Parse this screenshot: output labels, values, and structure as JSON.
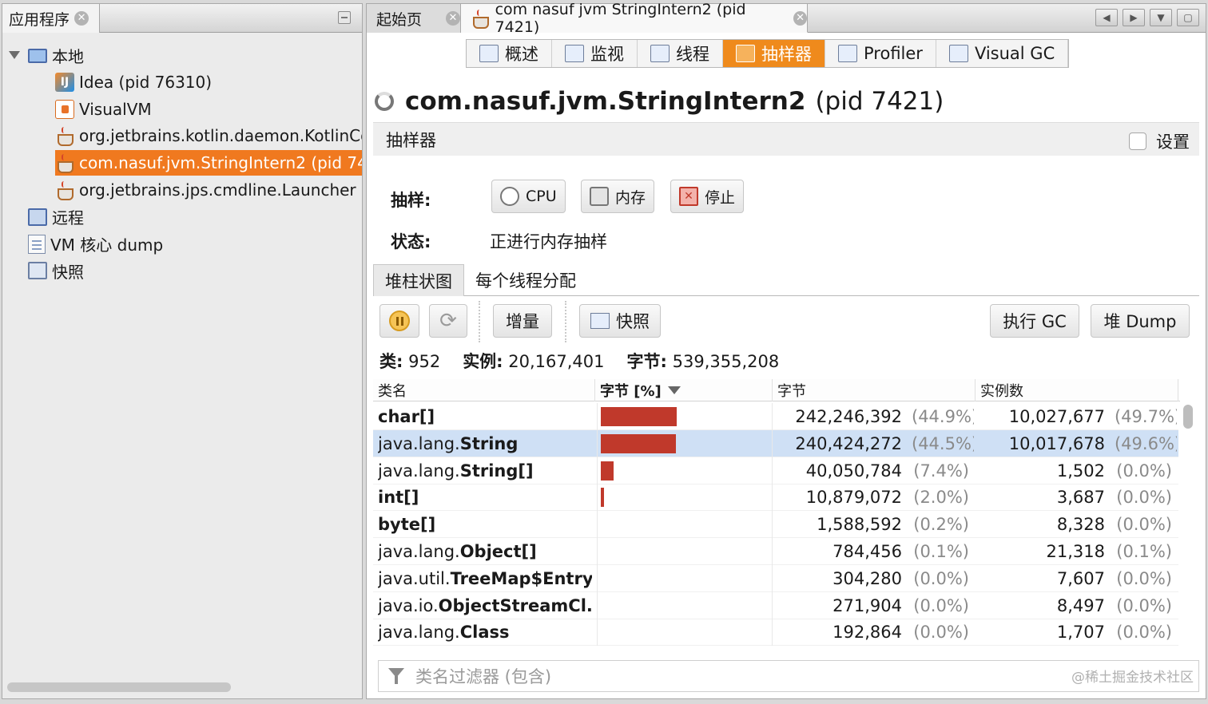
{
  "left_panel": {
    "tab_label": "应用程序",
    "tree": [
      {
        "label": "本地",
        "icon": "computer-icon",
        "level": 0,
        "expandable": true
      },
      {
        "label": "Idea (pid 76310)",
        "icon": "idea-icon",
        "level": 1
      },
      {
        "label": "VisualVM",
        "icon": "visualvm-icon",
        "level": 1
      },
      {
        "label": "org.jetbrains.kotlin.daemon.KotlinCo",
        "icon": "java-coffee-icon",
        "level": 1
      },
      {
        "label": "com.nasuf.jvm.StringIntern2 (pid 74",
        "icon": "java-coffee-icon",
        "level": 1,
        "selected": true
      },
      {
        "label": "org.jetbrains.jps.cmdline.Launcher (",
        "icon": "java-coffee-icon",
        "level": 1
      },
      {
        "label": "远程",
        "icon": "remote-host-icon",
        "level": 0
      },
      {
        "label": "VM 核心 dump",
        "icon": "core-dump-icon",
        "level": 0
      },
      {
        "label": "快照",
        "icon": "snapshot-icon",
        "level": 0
      }
    ]
  },
  "right_panel": {
    "tabs": [
      {
        "label": "起始页"
      },
      {
        "label": "com nasuf jvm StringIntern2 (pid 7421)",
        "active": true
      }
    ],
    "subtabs": [
      "概述",
      "监视",
      "线程",
      "抽样器",
      "Profiler",
      "Visual GC"
    ],
    "active_subtab": "抽样器",
    "app_title_name": "com.nasuf.jvm.StringIntern2",
    "app_title_pid": "(pid 7421)",
    "section_title": "抽样器",
    "settings_label": "设置",
    "sample_label": "抽样:",
    "buttons": {
      "cpu": "CPU",
      "memory": "内存",
      "stop": "停止"
    },
    "status_label": "状态:",
    "status_value": "正进行内存抽样",
    "view_tabs": [
      "堆柱状图",
      "每个线程分配"
    ],
    "toolbar": {
      "delta": "增量",
      "snapshot": "快照",
      "gc": "执行 GC",
      "heap_dump": "堆 Dump"
    },
    "summary": {
      "classes_label": "类:",
      "classes_value": "952",
      "instances_label": "实例:",
      "instances_value": "20,167,401",
      "bytes_label": "字节:",
      "bytes_value": "539,355,208"
    },
    "table": {
      "columns": [
        "类名",
        "字节 [%]",
        "字节",
        "实例数"
      ],
      "sorted_column": "字节 [%]",
      "rows": [
        {
          "pkg": "",
          "cls": "char[]",
          "bytes": "242,246,392",
          "bytes_pct": "(44.9%)",
          "inst": "10,027,677",
          "inst_pct": "(49.7%)",
          "share": 0.449
        },
        {
          "pkg": "java.lang.",
          "cls": "String",
          "bytes": "240,424,272",
          "bytes_pct": "(44.5%)",
          "inst": "10,017,678",
          "inst_pct": "(49.6%)",
          "share": 0.445,
          "selected": true
        },
        {
          "pkg": "java.lang.",
          "cls": "String[]",
          "bytes": "40,050,784",
          "bytes_pct": "(7.4%)",
          "inst": "1,502",
          "inst_pct": "(0.0%)",
          "share": 0.074
        },
        {
          "pkg": "",
          "cls": "int[]",
          "bytes": "10,879,072",
          "bytes_pct": "(2.0%)",
          "inst": "3,687",
          "inst_pct": "(0.0%)",
          "share": 0.02
        },
        {
          "pkg": "",
          "cls": "byte[]",
          "bytes": "1,588,592",
          "bytes_pct": "(0.2%)",
          "inst": "8,328",
          "inst_pct": "(0.0%)",
          "share": 0.002
        },
        {
          "pkg": "java.lang.",
          "cls": "Object[]",
          "bytes": "784,456",
          "bytes_pct": "(0.1%)",
          "inst": "21,318",
          "inst_pct": "(0.1%)",
          "share": 0.001
        },
        {
          "pkg": "java.util.",
          "cls": "TreeMap$Entry",
          "bytes": "304,280",
          "bytes_pct": "(0.0%)",
          "inst": "7,607",
          "inst_pct": "(0.0%)",
          "share": 0
        },
        {
          "pkg": "java.io.",
          "cls": "ObjectStreamCl...",
          "bytes": "271,904",
          "bytes_pct": "(0.0%)",
          "inst": "8,497",
          "inst_pct": "(0.0%)",
          "share": 0
        },
        {
          "pkg": "java.lang.",
          "cls": "Class",
          "bytes": "192,864",
          "bytes_pct": "(0.0%)",
          "inst": "1,707",
          "inst_pct": "(0.0%)",
          "share": 0
        }
      ]
    },
    "filter_placeholder": "类名过滤器 (包含)",
    "watermark": "@稀土掘金技术社区"
  },
  "colors": {
    "accent": "#f0791f",
    "bar": "#c0392b",
    "selected_row": "#cfe0f5"
  }
}
